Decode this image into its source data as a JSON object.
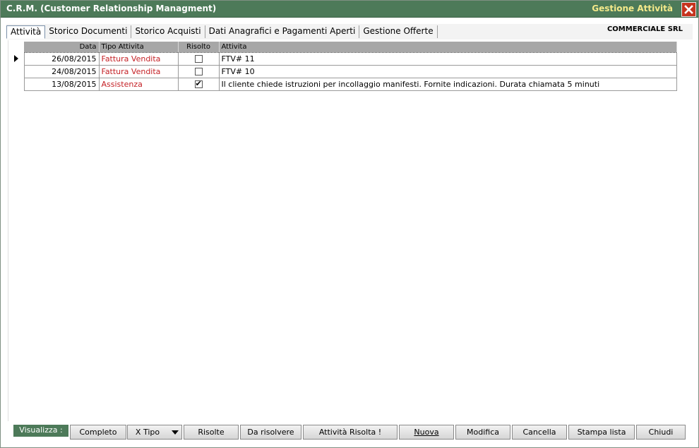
{
  "titlebar": {
    "app_title": "C.R.M.  (Customer Relationship Managment)",
    "window_title": "Gestione Attività",
    "close_icon": "close-icon"
  },
  "tabs": [
    {
      "label": "Attività",
      "active": true
    },
    {
      "label": "Storico Documenti",
      "active": false
    },
    {
      "label": "Storico Acquisti",
      "active": false
    },
    {
      "label": "Dati Anagrafici e Pagamenti Aperti",
      "active": false
    },
    {
      "label": "Gestione Offerte",
      "active": false
    }
  ],
  "company_name": "COMMERCIALE SRL",
  "grid": {
    "columns": [
      "Data",
      "Tipo Attivita",
      "Risolto",
      "Attivita"
    ],
    "rows": [
      {
        "date": "26/08/2015",
        "type": "Fattura Vendita",
        "resolved": false,
        "activity": "FTV# 11",
        "current": true
      },
      {
        "date": "24/08/2015",
        "type": "Fattura Vendita",
        "resolved": false,
        "activity": "FTV# 10",
        "current": false
      },
      {
        "date": "13/08/2015",
        "type": "Assistenza",
        "resolved": true,
        "activity": "Il cliente chiede istruzioni per incollaggio manifesti. Fornite indicazioni. Durata chiamata 5 minuti",
        "current": false
      }
    ],
    "type_color": "#c41f24"
  },
  "toolbar": {
    "visualizza_label": "Visualizza :",
    "completo": "Completo",
    "xtipo": "X Tipo",
    "risolte": "Risolte",
    "da_risolvere": "Da risolvere",
    "attivita_risolta": "Attività Risolta !",
    "nuova": "Nuova",
    "modifica": "Modifica",
    "cancella": "Cancella",
    "stampa_lista": "Stampa lista",
    "chiudi": "Chiudi"
  },
  "colors": {
    "titlebar": "#4d7a59",
    "window_title": "#f4e98a",
    "close_button": "#c6341e",
    "header": "#a7a7a7"
  }
}
